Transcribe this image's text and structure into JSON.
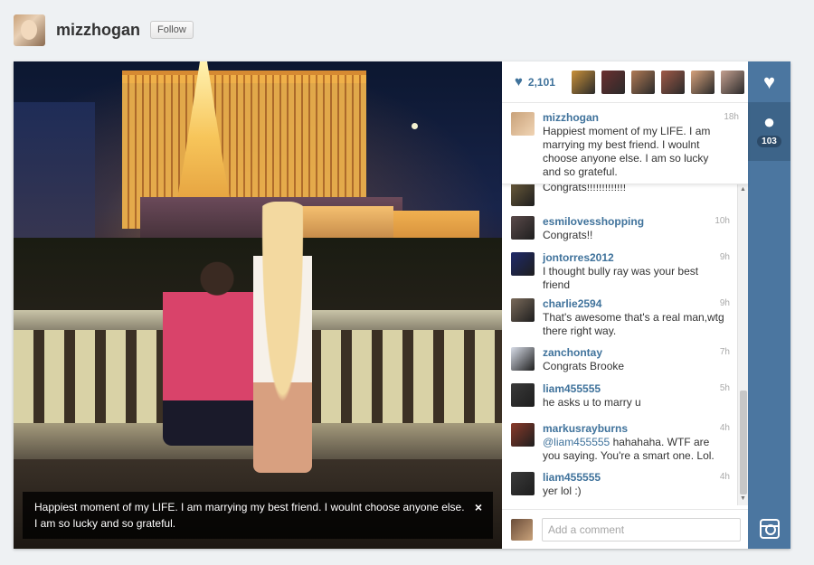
{
  "header": {
    "username": "mizzhogan",
    "follow_label": "Follow"
  },
  "photo": {
    "caption": "Happiest moment of my LIFE. I am marrying my best friend. I woulnt choose anyone else. I am so lucky and so grateful.",
    "close_glyph": "×"
  },
  "likes": {
    "count": "2,101",
    "heart_glyph": "♥",
    "thumb_colors": [
      "#c9913a",
      "#6b3030",
      "#b07a55",
      "#a05a48",
      "#d6a27c",
      "#c4a090"
    ]
  },
  "caption_comment": {
    "user": "mizzhogan",
    "time": "18h",
    "text": "Happiest moment of my LIFE. I am marrying my best friend. I woulnt choose anyone else. I am so lucky and so grateful."
  },
  "comments": [
    {
      "user": "",
      "time": "",
      "text": "Congrats!!!!!!!!!!!!!",
      "color": "#6a5a3a"
    },
    {
      "user": "esmilovesshopping",
      "time": "10h",
      "text": "Congrats!!",
      "color": "#5a4a4a"
    },
    {
      "user": "jontorres2012",
      "time": "9h",
      "text": "I thought bully ray was your best friend",
      "color": "#1f2a6a"
    },
    {
      "user": "charlie2594",
      "time": "9h",
      "text": "That's awesome that's a real man,wtg there right way.",
      "color": "#7a6a5a"
    },
    {
      "user": "zanchontay",
      "time": "7h",
      "text": "Congrats Brooke",
      "color": "#d8dde8"
    },
    {
      "user": "liam455555",
      "time": "5h",
      "text": "he asks u to marry u",
      "color": "#3a3a3a"
    },
    {
      "user": "markusrayburns",
      "time": "4h",
      "mention": "@liam455555",
      "text": " hahahaha. WTF are you saying. You're a smart one. Lol.",
      "color": "#8a3a2a"
    },
    {
      "user": "liam455555",
      "time": "4h",
      "text": "yer lol :)",
      "color": "#3a3a3a"
    }
  ],
  "comment_box": {
    "placeholder": "Add a comment"
  },
  "side_rail": {
    "comment_count": "103",
    "like_icon": "♥",
    "comment_icon": "●"
  }
}
